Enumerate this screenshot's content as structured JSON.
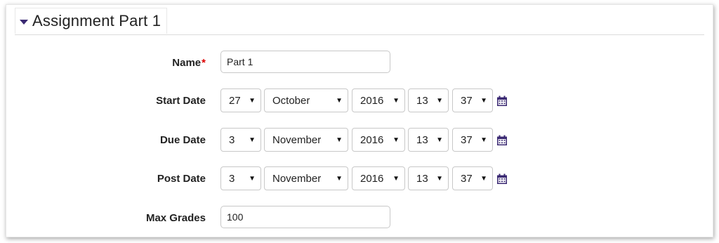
{
  "section": {
    "title": "Assignment Part 1"
  },
  "fields": {
    "name": {
      "label": "Name",
      "required_mark": "*",
      "value": "Part 1"
    },
    "start_date": {
      "label": "Start Date",
      "day": "27",
      "month": "October",
      "year": "2016",
      "hour": "13",
      "minute": "37"
    },
    "due_date": {
      "label": "Due Date",
      "day": "3",
      "month": "November",
      "year": "2016",
      "hour": "13",
      "minute": "37"
    },
    "post_date": {
      "label": "Post Date",
      "day": "3",
      "month": "November",
      "year": "2016",
      "hour": "13",
      "minute": "37"
    },
    "max_grades": {
      "label": "Max Grades",
      "value": "100"
    }
  },
  "icons": {
    "collapse": "caret-down-icon",
    "calendar": "calendar-icon",
    "dropdown": "dropdown-arrow-icon"
  },
  "colors": {
    "accent": "#3b2a73",
    "required": "#dd0000"
  }
}
